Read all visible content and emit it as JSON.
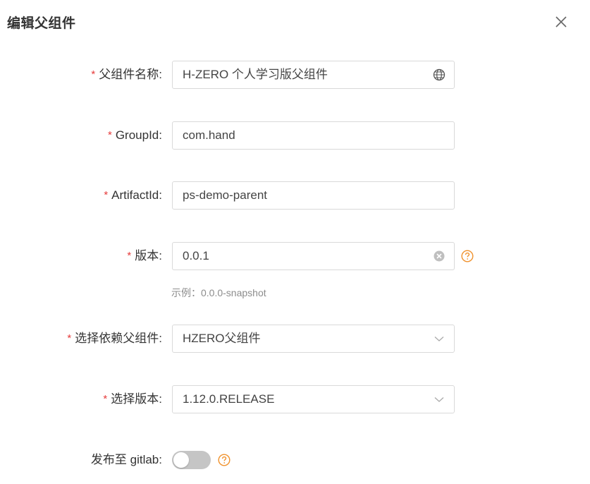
{
  "modal": {
    "title": "编辑父组件"
  },
  "form": {
    "required_mark": "*",
    "colon": ":",
    "parent_name": {
      "label": "父组件名称",
      "value": "H-ZERO 个人学习版父组件"
    },
    "group_id": {
      "label": "GroupId",
      "value": "com.hand"
    },
    "artifact_id": {
      "label": "ArtifactId",
      "value": "ps-demo-parent"
    },
    "version": {
      "label": "版本",
      "value": "0.0.1",
      "hint": "示例：0.0.0-snapshot"
    },
    "dependency_parent": {
      "label": "选择依赖父组件",
      "value": "HZERO父组件"
    },
    "dependency_version": {
      "label": "选择版本",
      "value": "1.12.0.RELEASE"
    },
    "publish_gitlab": {
      "label": "发布至 gitlab",
      "enabled": false
    }
  },
  "colors": {
    "required": "#e63b3b",
    "help_icon": "#f0922d",
    "switch_off": "#c5c5c5",
    "border": "#d9d9d9"
  },
  "icons": [
    "close-icon",
    "globe-icon",
    "clear-icon",
    "help-icon",
    "chevron-down-icon"
  ]
}
